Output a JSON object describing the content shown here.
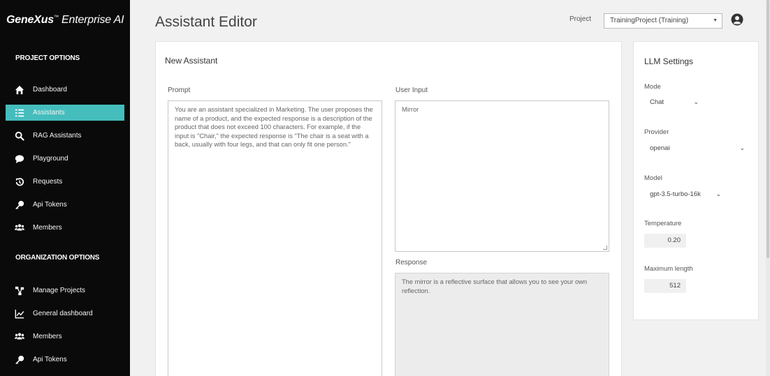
{
  "brand": {
    "name_bold": "GeneXus",
    "name_rest": " Enterprise AI",
    "mark": "™"
  },
  "sidebar": {
    "project_section": "PROJECT OPTIONS",
    "project_items": [
      {
        "label": "Dashboard",
        "icon": "home-icon"
      },
      {
        "label": "Assistants",
        "icon": "list-icon",
        "active": true
      },
      {
        "label": "RAG Assistants",
        "icon": "search-icon"
      },
      {
        "label": "Playground",
        "icon": "chat-icon"
      },
      {
        "label": "Requests",
        "icon": "history-icon"
      },
      {
        "label": "Api Tokens",
        "icon": "key-icon"
      },
      {
        "label": "Members",
        "icon": "users-icon"
      }
    ],
    "org_section": "ORGANIZATION OPTIONS",
    "org_items": [
      {
        "label": "Manage Projects",
        "icon": "sitemap-icon"
      },
      {
        "label": "General dashboard",
        "icon": "chart-line-icon"
      },
      {
        "label": "Members",
        "icon": "users-icon"
      },
      {
        "label": "Api Tokens",
        "icon": "key-icon"
      }
    ],
    "active_color": "#45bdbd"
  },
  "header": {
    "title": "Assistant Editor",
    "project_label": "Project",
    "project_value": "TrainingProject (Training)"
  },
  "editor": {
    "card_title": "New Assistant",
    "prompt_label": "Prompt",
    "prompt_value": "You are an assistant specialized in Marketing. The user proposes the name of a product, and the expected response is a description of the product that does not exceed 100 characters. For example, if the input is \"Chair,\" the expected response is \"The chair is a seat with a back, usually with four legs, and that can only fit one person.\"",
    "user_input_label": "User Input",
    "user_input_value": "Mirror",
    "response_label": "Response",
    "response_value": "The mirror is a reflective surface that allows you to see your own reflection."
  },
  "llm": {
    "title": "LLM Settings",
    "mode_label": "Mode",
    "mode_value": "Chat",
    "provider_label": "Provider",
    "provider_value": "openai",
    "model_label": "Model",
    "model_value": "gpt-3.5-turbo-16k",
    "temperature_label": "Temperature",
    "temperature_value": "0.20",
    "max_length_label": "Maximum length",
    "max_length_value": "512"
  }
}
